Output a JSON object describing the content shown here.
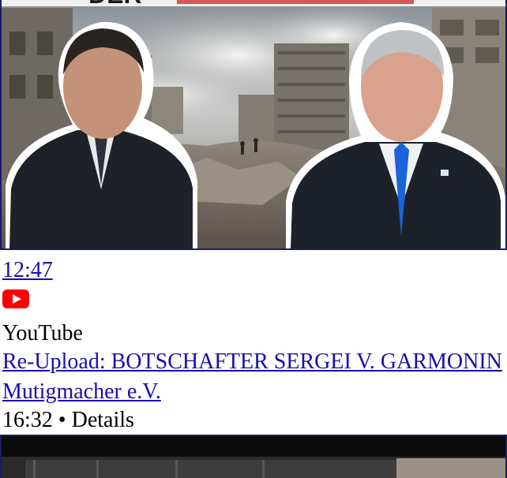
{
  "result1": {
    "thumbnail_alt": "Video thumbnail",
    "thumbnail_banner_text": "DER",
    "duration": "12:47",
    "source_icon": "youtube-play-icon",
    "source_name": "YouTube"
  },
  "result2": {
    "title": "Re-Upload: BOTSCHAFTER SERGEI V. GARMONIN",
    "channel": "Mutigmacher e.V.",
    "duration": "16:32",
    "separator": "•",
    "details_label": "Details"
  },
  "colors": {
    "link": "#1a0dab",
    "youtube_red": "#ff0000",
    "thumbnail_border": "#1a1a6a"
  }
}
